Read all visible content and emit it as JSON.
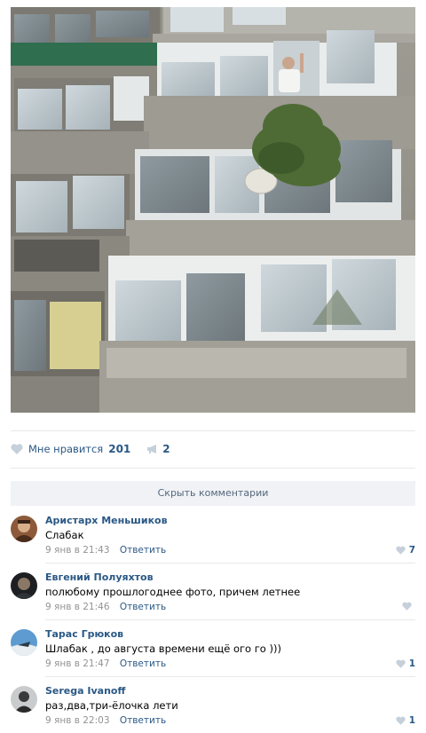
{
  "post": {
    "photo_alt": "balcony-photo",
    "likes": {
      "label": "Мне нравится",
      "count": "201"
    },
    "shares": {
      "count": "2"
    },
    "hide_comments_label": "Скрыть комментарии",
    "colors": {
      "link": "#2a5885",
      "muted": "#939393",
      "heart": "#c5d0db",
      "bar": "#f0f2f5"
    }
  },
  "comments": [
    {
      "author": "Аристарх Меньшиков",
      "text": "Слабак",
      "date": "9 янв в 21:43",
      "reply": "Ответить",
      "likes": "7",
      "avatar_icon": "avatar-photo"
    },
    {
      "author": "Евгений Полуяхтов",
      "text": "полюбому прошлогоднее фото, причем летнее",
      "date": "9 янв в 21:46",
      "reply": "Ответить",
      "likes": "",
      "avatar_icon": "avatar-photo"
    },
    {
      "author": "Тарас Грюков",
      "text": "Шлабак , до августа времени ещё ого го )))",
      "date": "9 янв в 21:47",
      "reply": "Ответить",
      "likes": "1",
      "avatar_icon": "avatar-photo"
    },
    {
      "author": "Serega Ivanoff",
      "text": "раз,два,три-ёлочка лети",
      "date": "9 янв в 22:03",
      "reply": "Ответить",
      "likes": "1",
      "avatar_icon": "avatar-photo"
    }
  ]
}
